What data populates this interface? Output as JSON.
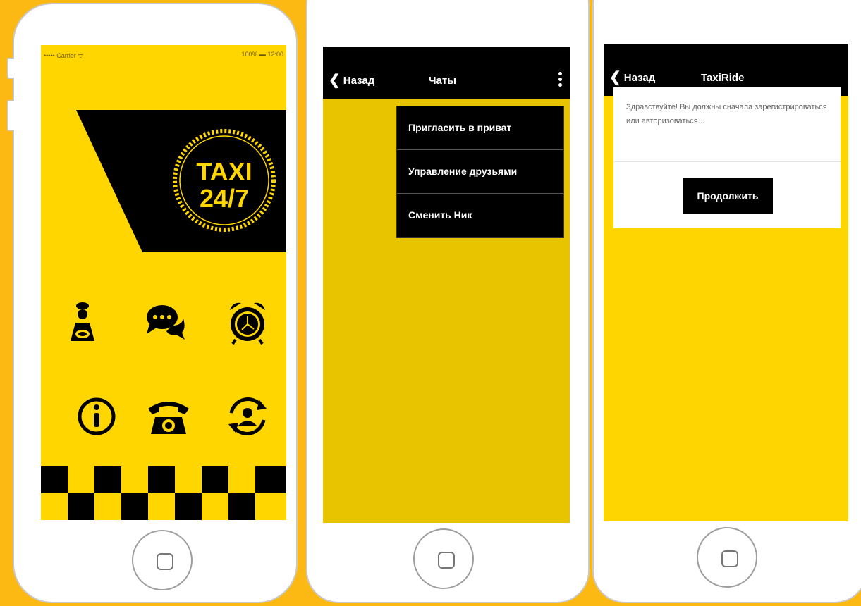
{
  "colors": {
    "background": "#fdb913",
    "yellow": "#ffd600",
    "black": "#000000"
  },
  "phone1": {
    "status": {
      "carrier": "••••• Carrier ᯤ",
      "right": "100% ▬ 12:00"
    },
    "logo_line1": "TAXI",
    "logo_line2": "24/7",
    "icons": [
      "driver-icon",
      "chat-icon",
      "alarm-clock-icon",
      "info-icon",
      "telephone-icon",
      "user-refresh-icon"
    ]
  },
  "phone2": {
    "back_label": "Назад",
    "title": "Чаты",
    "menu": [
      "Пригласить в приват",
      "Управление друзьями",
      "Сменить Ник"
    ]
  },
  "phone3": {
    "back_label": "Назад",
    "title": "TaxiRide",
    "message": "Здравствуйте! Вы должны сначала зарегистрироваться или авторизоваться...",
    "button_label": "Продолжить"
  }
}
